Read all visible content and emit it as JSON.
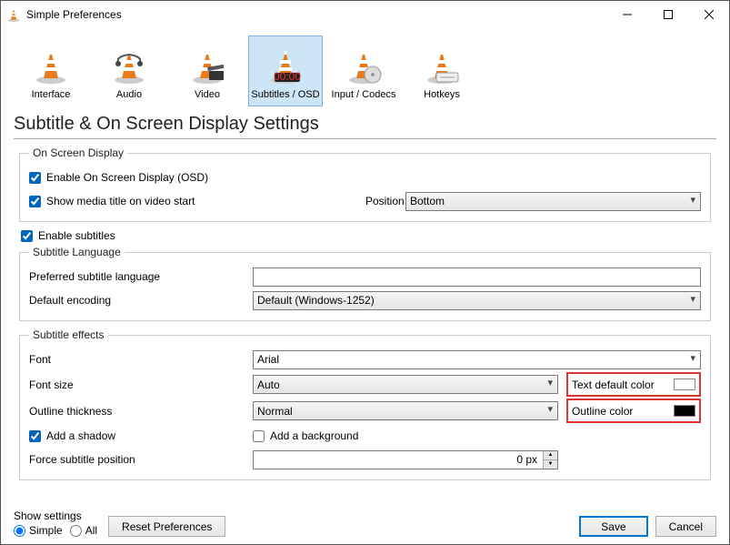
{
  "window": {
    "title": "Simple Preferences"
  },
  "tabs": {
    "interface": "Interface",
    "audio": "Audio",
    "video": "Video",
    "subtitles": "Subtitles / OSD",
    "input": "Input / Codecs",
    "hotkeys": "Hotkeys"
  },
  "page_title": "Subtitle & On Screen Display Settings",
  "osd": {
    "legend": "On Screen Display",
    "enable_osd": "Enable On Screen Display (OSD)",
    "show_title": "Show media title on video start",
    "position_label": "Position",
    "position_value": "Bottom"
  },
  "enable_subtitles": "Enable subtitles",
  "lang": {
    "legend": "Subtitle Language",
    "pref_label": "Preferred subtitle language",
    "pref_value": "",
    "enc_label": "Default encoding",
    "enc_value": "Default (Windows-1252)"
  },
  "fx": {
    "legend": "Subtitle effects",
    "font_label": "Font",
    "font_value": "Arial",
    "size_label": "Font size",
    "size_value": "Auto",
    "textcolor_label": "Text default color",
    "textcolor": "#ffffff",
    "outline_label": "Outline thickness",
    "outline_value": "Normal",
    "outlinecolor_label": "Outline color",
    "outlinecolor": "#000000",
    "shadow": "Add a shadow",
    "background": "Add a background",
    "force_label": "Force subtitle position",
    "force_value": "0 px"
  },
  "bottom": {
    "show_label": "Show settings",
    "simple": "Simple",
    "all": "All",
    "reset": "Reset Preferences",
    "save": "Save",
    "cancel": "Cancel"
  }
}
